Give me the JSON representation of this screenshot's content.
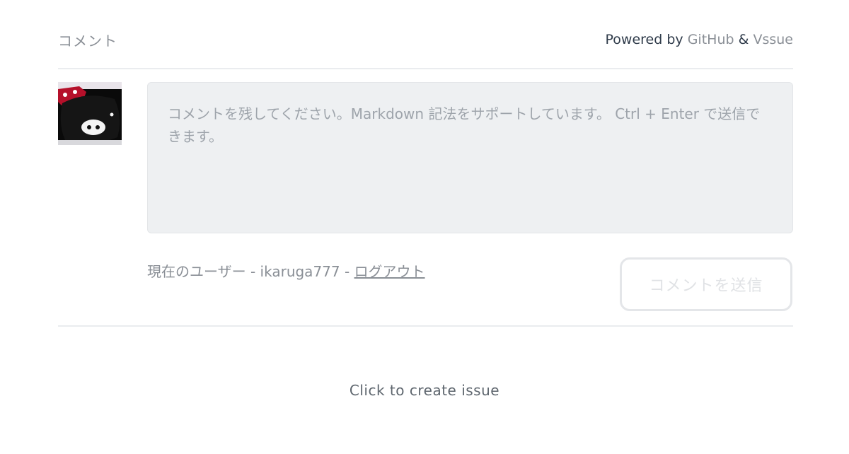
{
  "header": {
    "title": "コメント",
    "powered_prefix": "Powered by",
    "github_label": "GitHub",
    "amp": "&",
    "vssue_label": "Vssue"
  },
  "avatar": {
    "alt": "avatar",
    "description_icon": "user-avatar-image"
  },
  "editor": {
    "placeholder": "コメントを残してください。Markdown 記法をサポートしています。 Ctrl + Enter で送信できます。",
    "value": ""
  },
  "user": {
    "prefix": "現在のユーザー - ",
    "username": "ikaruga777",
    "separator": " - ",
    "logout_label": "ログアウト"
  },
  "submit": {
    "label": "コメントを送信",
    "disabled": true
  },
  "footer": {
    "create_issue_label": "Click to create issue"
  },
  "colors": {
    "muted_text": "#8a8f96",
    "textarea_bg": "#eef0f2",
    "disabled_button": "#e0e2e5",
    "divider": "#eaecef"
  }
}
